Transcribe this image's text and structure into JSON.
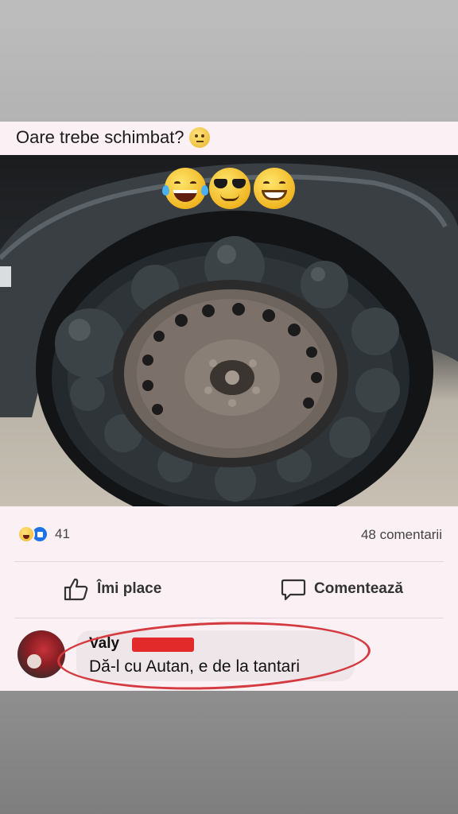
{
  "post": {
    "caption": "Oare trebe schimbat?",
    "caption_emoji": "thinking-face-emoji",
    "photo_overlay_emojis": [
      "tears-of-joy-emoji",
      "sunglasses-emoji",
      "grinning-emoji"
    ],
    "photo_subject": "car-wheel-with-bulging-tire"
  },
  "stats": {
    "reactions": [
      "haha-reaction-icon",
      "like-reaction-icon"
    ],
    "reaction_count": "41",
    "comments_count": "48 comentarii"
  },
  "actions": {
    "like_label": "Îmi place",
    "comment_label": "Comentează"
  },
  "comment": {
    "author": "Valy",
    "text": "Dă-l cu Autan, e de la tantari",
    "redaction_color": "#e22a2a",
    "highlight_circle_color": "#d43a3f"
  },
  "colors": {
    "post_background": "#fbf0f3",
    "like_blue": "#1d72e8"
  }
}
